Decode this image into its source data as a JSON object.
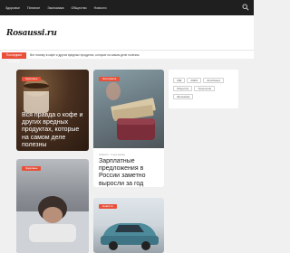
{
  "nav": {
    "links": [
      "Здоровье",
      "Питание",
      "Экономика",
      "Общество",
      "Новости"
    ]
  },
  "header": {
    "logo": "Rosaussi.ru"
  },
  "ticker": {
    "badge": "Последние новости",
    "text": "Вот почему в кофе и других вредных продуктах, которые на самом деле полезны"
  },
  "cards": [
    {
      "category": "Здоровье",
      "title": "Вся правда о кофе и других вредных продуктах, которые на самом деле полезны"
    },
    {
      "category": "Экономика",
      "meta": "Новости · 3 дня назад",
      "title": "Зарплатные предложения в России заметно выросли за год"
    },
    {
      "category": "Здоровье"
    },
    {
      "category": "Новости"
    }
  ],
  "sidebar": {
    "tags": [
      "АЗЕ",
      "Alfabit",
      "Автобизнес",
      "Общество",
      "Технологии",
      "Экономика"
    ]
  },
  "colors": {
    "accent": "#e8503a",
    "nav_bg": "#1f1f1f"
  }
}
